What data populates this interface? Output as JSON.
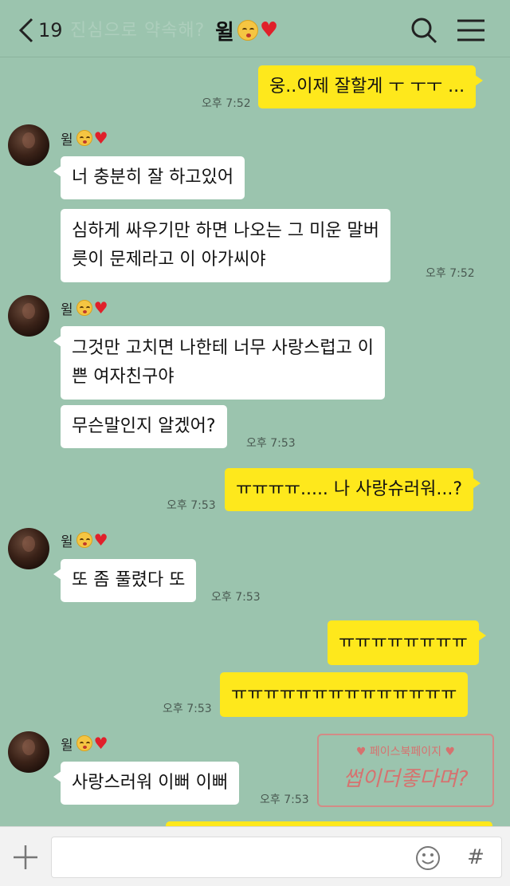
{
  "header": {
    "back_count": "19",
    "ghost_title": "진심으로 약속해?",
    "title": "윌"
  },
  "messages": [
    {
      "text": "웅..이제 잘할게 ㅜ ㅜㅜ ...",
      "time": "오후 7:52"
    },
    {
      "sender": "윌",
      "text": "너 충분히 잘 하고있어"
    },
    {
      "line1": "심하게 싸우기만 하면 나오는 그 미운 말버",
      "line2": "릇이 문제라고 이 아가씨야",
      "time": "오후 7:52"
    },
    {
      "sender": "윌",
      "line1": "그것만 고치면 나한테 너무 사랑스럽고 이",
      "line2": "쁜 여자친구야"
    },
    {
      "text": "무슨말인지 알겠어?",
      "time": "오후 7:53"
    },
    {
      "text": "ㅠㅠㅠㅠ..... 나 사랑슈러워...?",
      "time": "오후 7:53"
    },
    {
      "sender": "윌",
      "text": "또 좀 풀렸다 또",
      "time": "오후 7:53"
    },
    {
      "text": "ㅠㅠㅠㅠㅠㅠㅠㅠ"
    },
    {
      "text": "ㅠㅠㅠㅠㅠㅠㅠㅠㅠㅠㅠㅠㅠㅠ",
      "time": "오후 7:53"
    },
    {
      "sender": "윌",
      "text": "사랑스러워 이뻐 이뻐",
      "time": "오후 7:53"
    }
  ],
  "watermark": {
    "top": "페이스북페이지",
    "bottom": "썹이더좋다며?"
  },
  "input": {
    "hash": "#"
  },
  "colors": {
    "background": "#9bc4ae",
    "my_bubble": "#fee81c",
    "other_bubble": "#ffffff"
  }
}
